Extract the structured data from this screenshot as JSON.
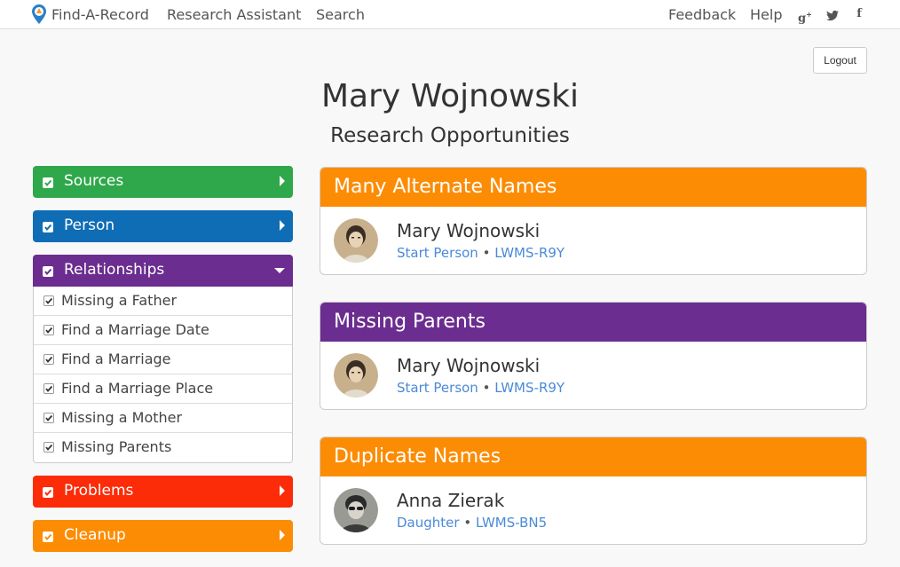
{
  "nav": {
    "brand": "Find-A-Record",
    "research_assistant": "Research Assistant",
    "search": "Search",
    "feedback": "Feedback",
    "help": "Help",
    "social_icons": [
      "google-plus-icon",
      "twitter-icon",
      "facebook-icon"
    ]
  },
  "logout_label": "Logout",
  "header": {
    "title": "Mary Wojnowski",
    "subtitle": "Research Opportunities"
  },
  "sidebar": {
    "categories": [
      {
        "label": "Sources",
        "color": "#2ea84a",
        "checked": true,
        "expanded": false
      },
      {
        "label": "Person",
        "color": "#0f6db5",
        "checked": true,
        "expanded": false
      },
      {
        "label": "Relationships",
        "color": "#6b2d8f",
        "checked": true,
        "expanded": true
      },
      {
        "label": "Problems",
        "color": "#fc2b08",
        "checked": true,
        "expanded": false
      },
      {
        "label": "Cleanup",
        "color": "#fc8c04",
        "checked": true,
        "expanded": false
      }
    ],
    "relationship_items": [
      {
        "label": "Missing a Father",
        "checked": true
      },
      {
        "label": "Find a Marriage Date",
        "checked": true
      },
      {
        "label": "Find a Marriage",
        "checked": true
      },
      {
        "label": "Find a Marriage Place",
        "checked": true
      },
      {
        "label": "Missing a Mother",
        "checked": true
      },
      {
        "label": "Missing Parents",
        "checked": true
      }
    ]
  },
  "cards": [
    {
      "title": "Many Alternate Names",
      "color": "#fc8c04",
      "person": "Mary Wojnowski",
      "relation": "Start Person",
      "separator": "•",
      "pid": "LWMS-R9Y"
    },
    {
      "title": "Missing Parents",
      "color": "#6b2d8f",
      "person": "Mary Wojnowski",
      "relation": "Start Person",
      "separator": "•",
      "pid": "LWMS-R9Y"
    },
    {
      "title": "Duplicate Names",
      "color": "#fc8c04",
      "person": "Anna Zierak",
      "relation": "Daughter",
      "separator": "•",
      "pid": "LWMS-BN5"
    }
  ]
}
